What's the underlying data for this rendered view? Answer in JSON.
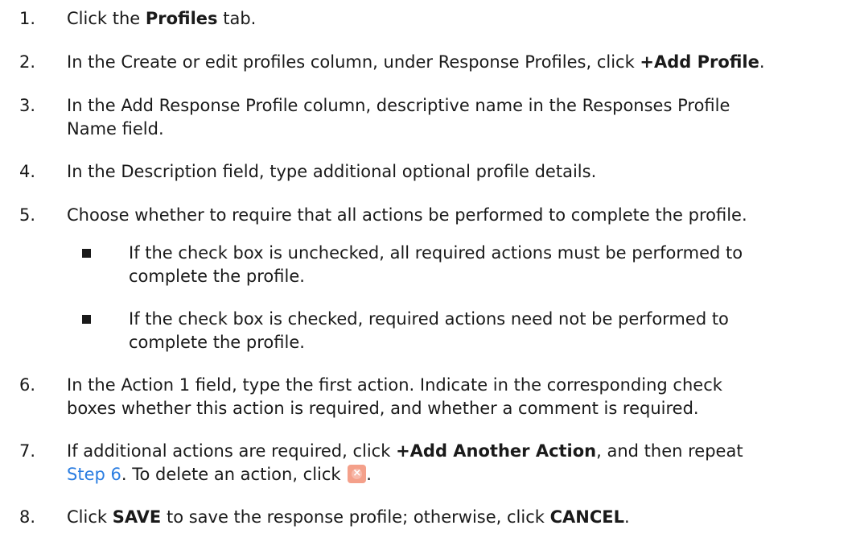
{
  "steps": [
    {
      "num": "1.",
      "parts": [
        "Click the ",
        "Profiles",
        " tab."
      ]
    },
    {
      "num": "2.",
      "parts": [
        "In the Create or edit profiles column, under Response Profiles, click ",
        "+Add Profile",
        "."
      ]
    },
    {
      "num": "3.",
      "text_line1": "In the Add Response Profile column, descriptive name in the Responses Profile",
      "text_line2": "Name field."
    },
    {
      "num": "4.",
      "text": "In the Description field, type additional optional profile details."
    },
    {
      "num": "5.",
      "text": "Choose whether to require that all actions be performed to complete the profile."
    },
    {
      "num": "6.",
      "text_line1": "In the Action 1 field, type the first action. Indicate in the corresponding check",
      "text_line2": "boxes whether this action is required, and whether a comment is required."
    },
    {
      "num": "7.",
      "parts_line1": [
        "If additional actions are required, click ",
        "+Add Another Action",
        ", and then repeat"
      ],
      "link": "Step 6",
      "after_link": ". To delete an action, click ",
      "end": "."
    },
    {
      "num": "8.",
      "parts": [
        "Click ",
        "SAVE",
        " to save the response profile; otherwise, click ",
        "CANCEL",
        "."
      ]
    }
  ],
  "bullets": [
    {
      "line1": "If the check box is unchecked, all required actions must be performed to",
      "line2": "complete the profile."
    },
    {
      "line1": "If the check box is checked, required actions need not be performed to",
      "line2": "complete the profile."
    }
  ],
  "icons": {
    "delete": "delete-x-icon",
    "bullet": "square-bullet-icon"
  },
  "colors": {
    "text": "#1a1a1a",
    "link": "#2a7de1",
    "delete_icon": "#f4a08a"
  }
}
